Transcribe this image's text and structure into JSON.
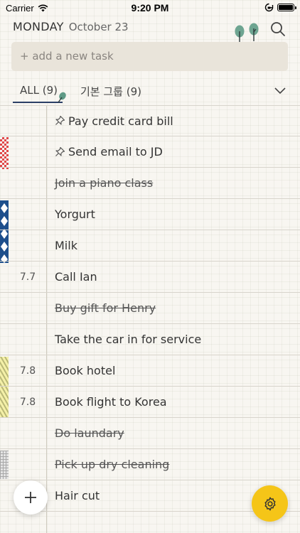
{
  "status_bar": {
    "carrier": "Carrier",
    "time": "9:20 PM",
    "battery_level": 1.0
  },
  "header": {
    "day": "MONDAY",
    "date": "October 23"
  },
  "add_task": {
    "placeholder": "+ add a new task"
  },
  "tabs": [
    {
      "label": "ALL (9)",
      "selected": true
    },
    {
      "label": "기본 그룹 (9)",
      "selected": false
    }
  ],
  "tasks": [
    {
      "date": "",
      "text": "Pay credit card bill",
      "pinned": true,
      "done": false
    },
    {
      "date": "",
      "text": "Send email to JD",
      "pinned": true,
      "done": false
    },
    {
      "date": "",
      "text": "Join a piano class",
      "pinned": false,
      "done": true
    },
    {
      "date": "",
      "text": "Yorgurt",
      "pinned": false,
      "done": false
    },
    {
      "date": "",
      "text": "Milk",
      "pinned": false,
      "done": false
    },
    {
      "date": "7.7",
      "text": "Call Ian",
      "pinned": false,
      "done": false
    },
    {
      "date": "",
      "text": "Buy gift for Henry",
      "pinned": false,
      "done": true
    },
    {
      "date": "",
      "text": "Take the car in for service",
      "pinned": false,
      "done": false
    },
    {
      "date": "7.8",
      "text": "Book hotel",
      "pinned": false,
      "done": false
    },
    {
      "date": "7.8",
      "text": "Book flight to Korea",
      "pinned": false,
      "done": false
    },
    {
      "date": "",
      "text": "Do laundary",
      "pinned": false,
      "done": true
    },
    {
      "date": "",
      "text": "Pick up dry cleaning",
      "pinned": false,
      "done": true
    },
    {
      "date": "",
      "text": "Hair cut",
      "pinned": false,
      "done": false
    }
  ],
  "icons": {
    "add_button": "plus-icon",
    "settings_button": "gear-icon",
    "search": "search-icon",
    "group_dropdown": "chevron-down-icon"
  },
  "colors": {
    "accent": "#f5c518",
    "tab_underline": "#2b3f66",
    "leaf": "#5f9a86"
  }
}
